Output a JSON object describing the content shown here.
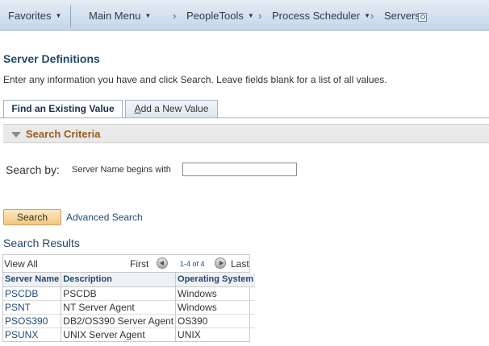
{
  "nav": {
    "favorites": "Favorites",
    "main_menu": "Main Menu",
    "breadcrumbs": [
      "PeopleTools",
      "Process Scheduler",
      "Servers"
    ]
  },
  "page": {
    "title": "Server Definitions",
    "instructions": "Enter any information you have and click Search. Leave fields blank for a list of all values."
  },
  "tabs": {
    "find": "Find an Existing Value",
    "add_prefix": "A",
    "add_rest": "dd a New Value"
  },
  "criteria": {
    "header": "Search Criteria",
    "search_by": "Search by:",
    "field_label": "Server Name begins with",
    "field_value": ""
  },
  "actions": {
    "search": "Search",
    "advanced_search": "Advanced Search"
  },
  "results": {
    "title": "Search Results",
    "view_all": "View All",
    "first": "First",
    "range": "1-4 of 4",
    "last": "Last",
    "columns": [
      "Server Name",
      "Description",
      "Operating System"
    ],
    "rows": [
      [
        "PSCDB",
        "PSCDB",
        "Windows"
      ],
      [
        "PSNT",
        "NT Server Agent",
        "Windows"
      ],
      [
        "PSOS390",
        "DB2/OS390 Server Agent",
        "OS390"
      ],
      [
        "PSUNX",
        "UNIX Server Agent",
        "UNIX"
      ]
    ]
  },
  "icons": {
    "nav_dropdown": "chevron-down-icon",
    "breadcrumb_sep": "chevron-right-icon",
    "page_search": "search-icon",
    "collapse": "triangle-down-icon",
    "prev": "previous-icon",
    "next": "next-icon"
  }
}
